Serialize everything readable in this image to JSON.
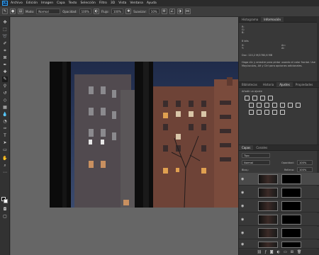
{
  "menubar": {
    "logo": "Ps",
    "items": [
      "Archivo",
      "Edición",
      "Imagen",
      "Capa",
      "Texto",
      "Selección",
      "Filtro",
      "3D",
      "Vista",
      "Ventana",
      "Ayuda"
    ]
  },
  "options": {
    "mode_label": "Modo:",
    "mode_value": "Normal",
    "opacity_label": "Opacidad:",
    "opacity_value": "100%",
    "flow_label": "Flujo:",
    "flow_value": "100%",
    "smooth_label": "Suavizar:",
    "smooth_value": "10%"
  },
  "info_panel": {
    "tabs": [
      "Histograma",
      "Información"
    ],
    "active_tab": "Información",
    "rgb_labels": [
      "R:",
      "G:",
      "B:"
    ],
    "bits": "8 bits",
    "xy_labels": [
      "X:",
      "Y:"
    ],
    "wh_labels": [
      "An:",
      "Al:"
    ],
    "doc": "Doc: 120,2 M/2780,6 MB",
    "hint": "Haga clic y arrastre para pintar usando el color frontal. Use Mayúsculas, Alt y Ctrl para opciones adicionales."
  },
  "adjust_panel": {
    "tabs": [
      "Bibliotecas",
      "Historia",
      "Ajustes",
      "Propiedades"
    ],
    "active_tab": "Ajustes",
    "add_label": "Añadir un ajuste"
  },
  "layers_panel": {
    "tabs": [
      "Capas",
      "Canales"
    ],
    "active_tab": "Capas",
    "filter_value": "Tipo",
    "blend_value": "Normal",
    "opacity_label": "Opacidad:",
    "opacity_value": "100%",
    "lock_label": "Bloq.:",
    "fill_label": "Relleno:",
    "fill_value": "100%"
  },
  "colors": {
    "accent": "#31a8ff",
    "panel": "#383838",
    "canvas": "#666666"
  }
}
